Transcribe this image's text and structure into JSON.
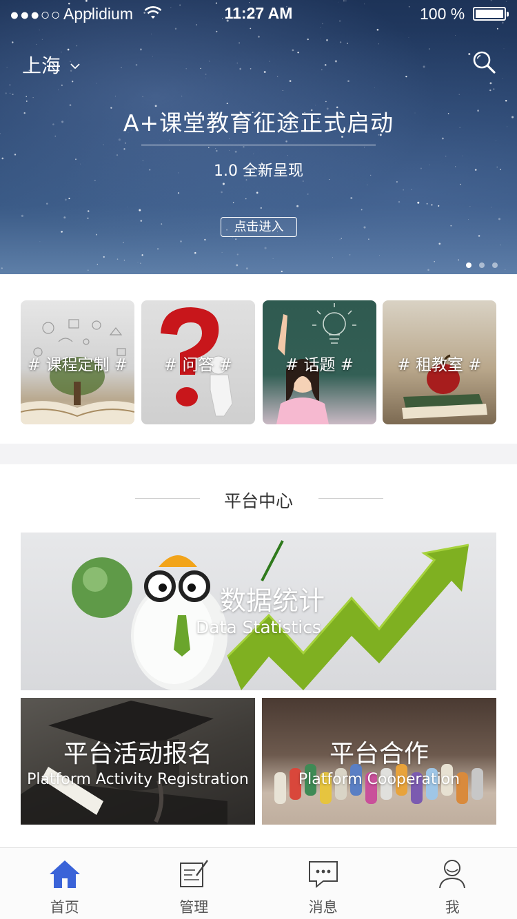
{
  "status_bar": {
    "signal": "●●●○○",
    "carrier": "Applidium",
    "time": "11:27 AM",
    "battery": "100 %"
  },
  "header": {
    "city": "上海"
  },
  "banner": {
    "title": "A+课堂教育征途正式启动",
    "subtitle": "1.0 全新呈现",
    "enter_label": "点击进入",
    "slide_count": 3,
    "active_slide": 1
  },
  "categories": [
    {
      "label": "# 课程定制 #"
    },
    {
      "label": "# 问答 #"
    },
    {
      "label": "# 话题 #"
    },
    {
      "label": "# 租教室 #"
    }
  ],
  "platform": {
    "heading": "平台中心",
    "data_stats": {
      "title": "数据统计",
      "subtitle": "Data Statistics"
    },
    "activity": {
      "title": "平台活动报名",
      "subtitle": "Platform Activity Registration"
    },
    "cooperation": {
      "title": "平台合作",
      "subtitle": "Platform Cooperation"
    }
  },
  "tabbar": {
    "active": "home",
    "accent_color": "#3a63d8",
    "items": [
      {
        "label": "首页",
        "icon": "home-icon"
      },
      {
        "label": "管理",
        "icon": "edit-icon"
      },
      {
        "label": "消息",
        "icon": "message-icon"
      },
      {
        "label": "我",
        "icon": "user-icon"
      }
    ]
  }
}
